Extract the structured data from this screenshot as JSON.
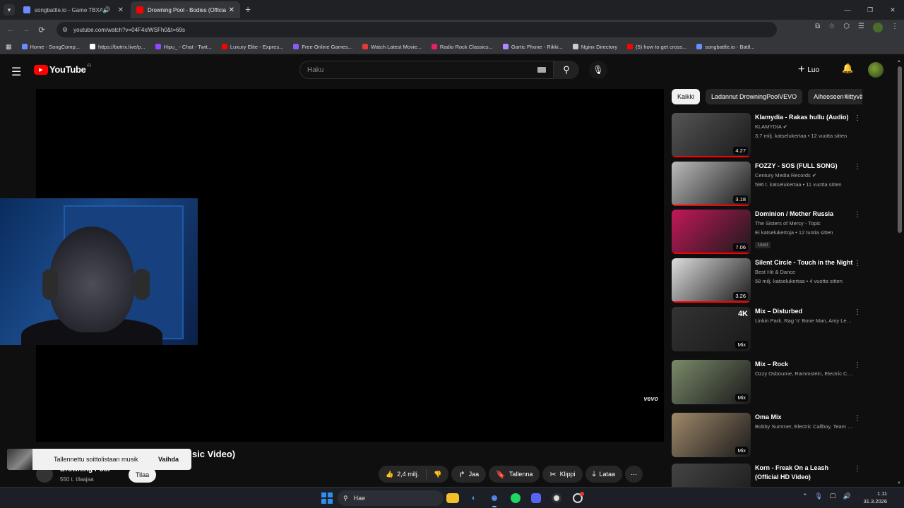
{
  "browser": {
    "tabs": [
      {
        "title": "songbattle.io - Game TBXA...",
        "audio": true
      },
      {
        "title": "Drowning Pool - Bodies (Officia",
        "active": true
      }
    ],
    "url": "youtube.com/watch?v=04F4xlWSFh0&t=69s",
    "bookmarks": [
      {
        "label": "Home - SongComp...",
        "color": "#6b8cff"
      },
      {
        "label": "https://botrix.live/p...",
        "color": "#ffffff"
      },
      {
        "label": "Hipu_ - Chat - Twit...",
        "color": "#9146ff"
      },
      {
        "label": "Luxury Elite - Expres...",
        "color": "#ff0000"
      },
      {
        "label": "Free Online Games...",
        "color": "#8a5cf6"
      },
      {
        "label": "Watch Latest Movie...",
        "color": "#e53935"
      },
      {
        "label": "Radio Rock Classics...",
        "color": "#e91e63"
      },
      {
        "label": "Gartic Phone - Rikki...",
        "color": "#b388ff"
      },
      {
        "label": "Nginx Directory",
        "color": "#cccccc"
      },
      {
        "label": "(5) how to get cross...",
        "color": "#ff0000"
      },
      {
        "label": "songbattle.io - Battl...",
        "color": "#6b8cff"
      }
    ]
  },
  "youtube": {
    "logo_text": "YouTube",
    "country_code": "FI",
    "search_placeholder": "Haku",
    "create_label": "Luo",
    "video_title_visible": "usic Video)",
    "channel_name": "Drowning Pool",
    "channel_subs": "550 t. tilaajaa",
    "subscribe_label": "Tilaa",
    "vevo_label": "vevo",
    "toast": {
      "message": "Tallennettu soittolistaan musik",
      "action": "Vaihda"
    },
    "actions": {
      "likes": "2,4 milj.",
      "share": "Jaa",
      "save": "Tallenna",
      "clip": "Klippi",
      "download": "Lataa"
    },
    "chips": [
      "Kaikki",
      "Ladannut DrowningPoolVEVO",
      "Aiheeseen liittyvät"
    ],
    "recommendations": [
      {
        "title": "Klamydia - Rakas hullu (Audio)",
        "channel": "KLAMYDIA",
        "verified": true,
        "meta": "3,7 milj. katselukertaa • 12 vuotta sitten",
        "duration": "4.27",
        "thumb": "#555"
      },
      {
        "title": "FOZZY - SOS (FULL SONG)",
        "channel": "Century Media Records",
        "verified": true,
        "meta": "596 t. katselukertaa • 11 vuotta sitten",
        "duration": "3.18",
        "thumb": "#bbb"
      },
      {
        "title": "Dominion / Mother Russia",
        "channel": "The Sisters of Mercy - Topic",
        "meta": "Ei katselukertoja • 12 tuntia sitten",
        "badge": "Uusi",
        "duration": "7.06",
        "thumb": "#c2185b"
      },
      {
        "title": "Silent Circle - Touch in the Night",
        "channel": "Best Hit & Dance",
        "meta": "58 milj. katselukertaa • 4 vuotta sitten",
        "duration": "3.26",
        "thumb": "#ddd"
      },
      {
        "title": "Mix – Disturbed",
        "channel": "Linkin Park, Rag 'n' Bone Man, Amy Lee ja...",
        "meta": "",
        "duration": "Mix",
        "corner": "4K",
        "thumb": "#333"
      },
      {
        "title": "Mix – Rock",
        "channel": "Ozzy Osbourne, Rammstein, Electric Call...",
        "meta": "",
        "duration": "Mix",
        "thumb": "#7a8a6a"
      },
      {
        "title": "Oma Mix",
        "channel": "Bobby Summer, Electric Callboy, Team S...",
        "meta": "",
        "duration": "Mix",
        "thumb": "#a0896a"
      },
      {
        "title": "Korn - Freak On a Leash (Official HD Video)",
        "channel": "",
        "meta": "",
        "duration": "",
        "thumb": "#444"
      }
    ]
  },
  "taskbar": {
    "search_label": "Hae",
    "time": "1.11",
    "date": "31.3.2026"
  }
}
